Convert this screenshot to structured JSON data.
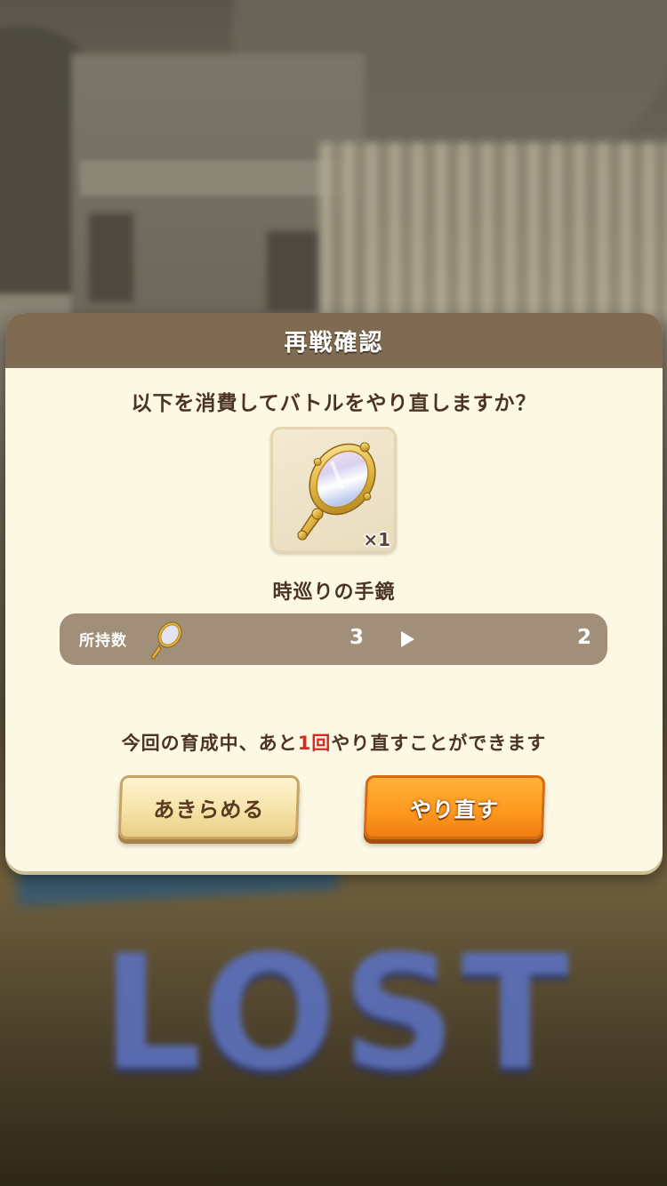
{
  "background": {
    "lost_text": "LOST"
  },
  "dialog": {
    "title": "再戦確認",
    "question": "以下を消費してバトルをやり直しますか？",
    "item": {
      "icon": "hand-mirror-icon",
      "quantity": "×1",
      "name": "時巡りの手鏡"
    },
    "owned": {
      "label": "所持数",
      "before": "3",
      "after": "2"
    },
    "remaining": {
      "prefix": "今回の育成中、あと",
      "count": "1回",
      "suffix": "やり直すことができます"
    },
    "buttons": {
      "give_up": "あきらめる",
      "retry": "やり直す"
    }
  },
  "colors": {
    "header": "#7f6a52",
    "panel": "#fdf8e3",
    "text": "#4b3424",
    "accent_red": "#d62b21",
    "retry_button": "#ff9a1f",
    "owned_bar": "#a28f79"
  }
}
